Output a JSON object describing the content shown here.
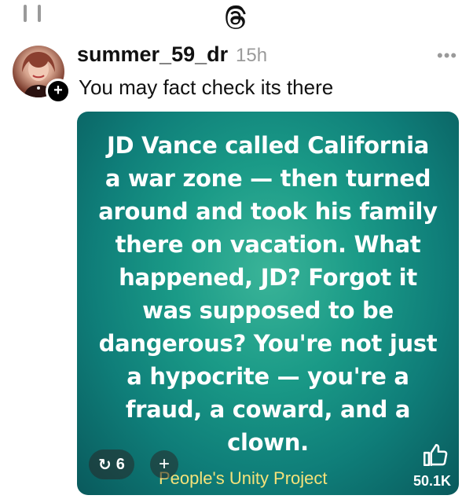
{
  "header": {
    "menu_icon": "hamburger-icon",
    "logo_icon": "threads-logo-icon"
  },
  "post": {
    "username": "summer_59_dr",
    "timestamp": "15h",
    "text": "You may fact check its there",
    "follow_badge": "+",
    "more_icon": "•••"
  },
  "media": {
    "lines": [
      "JD Vance called California",
      "a war zone — then turned",
      "around and took his family",
      "there on vacation. What",
      "happened, JD? Forgot it",
      "was supposed to be",
      "dangerous? You're not just",
      "a hypocrite — you're a",
      "fraud, a coward, and a",
      "clown."
    ],
    "watermark": "People's Unity Project",
    "repost_count": "6",
    "repost_icon": "↻",
    "add_label": "+",
    "like_count": "50.1K",
    "background_color": "#15917f",
    "watermark_color": "#f5e27a"
  }
}
